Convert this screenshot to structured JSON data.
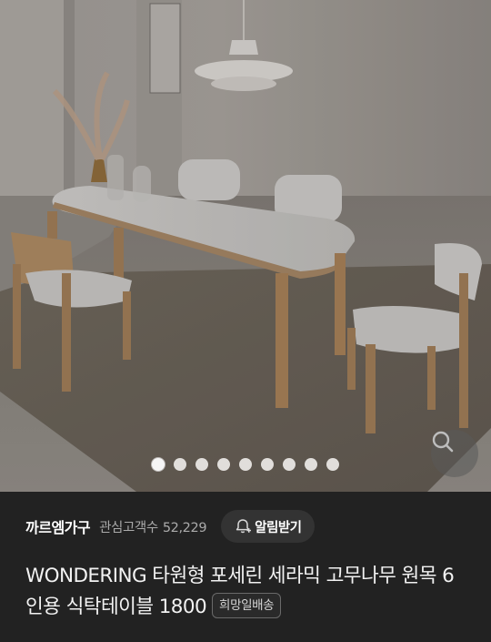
{
  "gallery": {
    "image_alt": "dining table with four chairs in a bright room",
    "page_count": 9,
    "current_page": 1
  },
  "store": {
    "name": "까르엠가구",
    "interest_label": "관심고객수",
    "interest_count": "52,229",
    "notify_label": "알림받기"
  },
  "product": {
    "title": "WONDERING 타원형 포세린 세라믹 고무나무 원목 6인용 식탁테이블 1800",
    "badge": "희망일배송"
  },
  "icons": {
    "zoom": "search-icon",
    "notify": "bell-plus-icon"
  },
  "colors": {
    "background": "#222222",
    "text": "#ffffff",
    "muted_text": "#aaaaaa",
    "pill": "#333333"
  }
}
